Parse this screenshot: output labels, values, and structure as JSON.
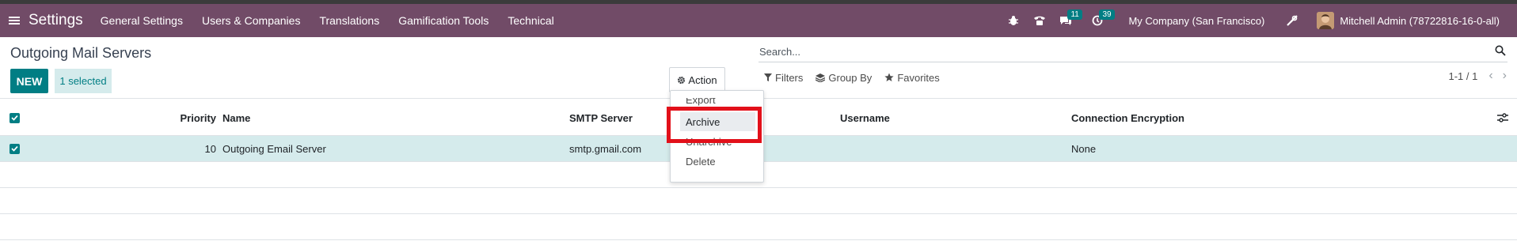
{
  "navbar": {
    "app_title": "Settings",
    "menu": [
      "General Settings",
      "Users & Companies",
      "Translations",
      "Gamification Tools",
      "Technical"
    ],
    "messages_count": "11",
    "activities_count": "39",
    "company": "My Company (San Francisco)",
    "user": "Mitchell Admin (78722816-16-0-all)",
    "icons": [
      "bug-icon",
      "phone-icon",
      "chat-icon",
      "clock-icon",
      "tools-icon"
    ],
    "color": "#714b67"
  },
  "control_panel": {
    "title": "Outgoing Mail Servers",
    "new_label": "NEW",
    "selected_label": "1 selected",
    "action_label": "Action",
    "search_placeholder": "Search...",
    "filters_label": "Filters",
    "group_by_label": "Group By",
    "favorites_label": "Favorites",
    "pager": "1-1 / 1"
  },
  "action_menu": {
    "items": [
      "Export",
      "Archive",
      "Unarchive",
      "Delete"
    ],
    "highlighted": "Archive"
  },
  "table": {
    "columns": [
      "Priority",
      "Name",
      "SMTP Server",
      "Username",
      "Connection Encryption"
    ],
    "rows": [
      {
        "priority": "10",
        "name": "Outgoing Email Server",
        "smtp": "smtp.gmail.com",
        "username": "",
        "encryption": "None",
        "selected": true
      }
    ]
  },
  "accent_color": "#017e84"
}
